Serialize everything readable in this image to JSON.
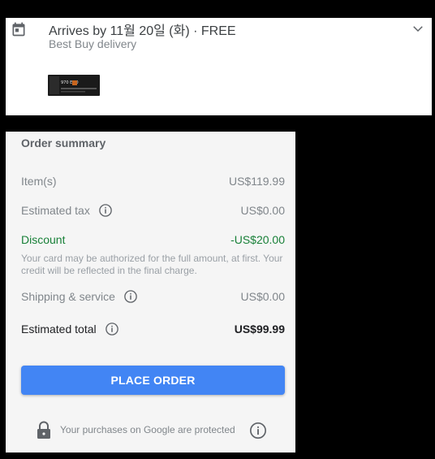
{
  "delivery": {
    "arrives_text": "Arrives by 11월 20일 (화) · FREE",
    "carrier": "Best Buy delivery",
    "product_image_label": "970 EVO",
    "icons": {
      "calendar": "calendar-icon",
      "expand": "chevron-down-icon"
    }
  },
  "summary": {
    "title": "Order summary",
    "items_label": "Item(s)",
    "items_value": "US$119.99",
    "tax_label": "Estimated tax",
    "tax_value": "US$0.00",
    "discount_label": "Discount",
    "discount_value": "-US$20.00",
    "note": "Your card may be authorized for the full amount, at first. Your credit will be reflected in the final charge.",
    "shipping_label": "Shipping & service",
    "shipping_value": "US$0.00",
    "total_label": "Estimated total",
    "total_value": "US$99.99",
    "place_order": "PLACE ORDER",
    "protected_text": "Your purchases on Google are protected"
  },
  "colors": {
    "accent": "#4285f4",
    "discount": "#188038"
  }
}
